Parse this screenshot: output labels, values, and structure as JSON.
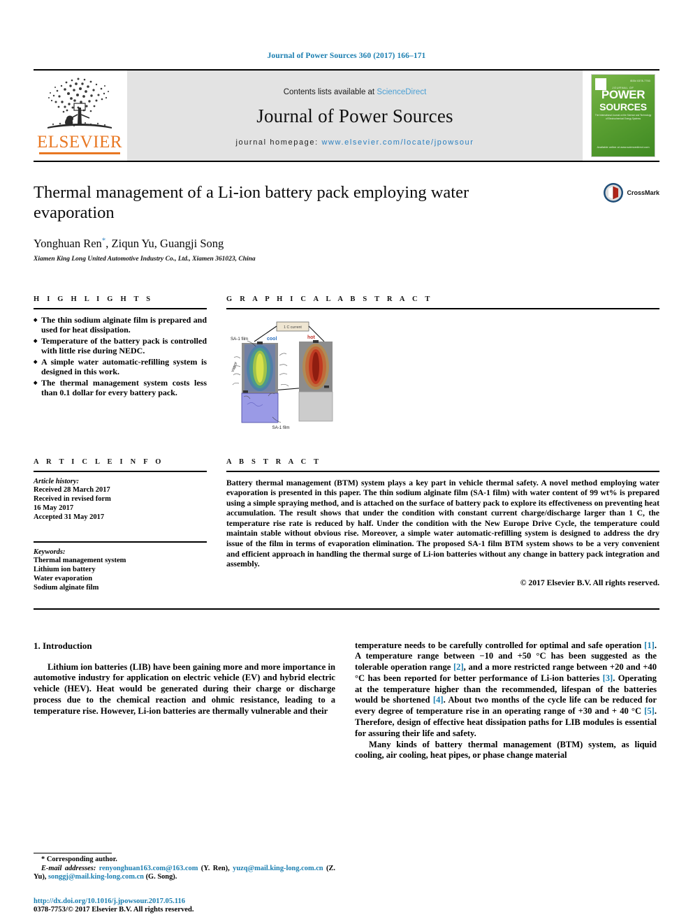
{
  "running_head": "Journal of Power Sources 360 (2017) 166–171",
  "masthead": {
    "publisher": "ELSEVIER",
    "contents_prefix": "Contents lists available at ",
    "contents_link": "ScienceDirect",
    "journal_title": "Journal of Power Sources",
    "homepage_prefix": "journal homepage: ",
    "homepage_url": "www.elsevier.com/locate/jpowsour",
    "cover": {
      "header": "ISSN 0378-7753",
      "eyebrow": "JOURNAL OF",
      "word1": "POWER",
      "word2": "SOURCES",
      "tagline": "The International Journal on the Science and Technology of Electrochemical Energy Systems",
      "footer": "Available online at\nwww.sciencedirect.com",
      "bg_color": "#5ba032"
    }
  },
  "article": {
    "title": "Thermal management of a Li-ion battery pack employing water evaporation",
    "authors": "Yonghuan Ren, Ziqun Yu, Guangji Song",
    "author_marker": "*",
    "affiliation": "Xiamen King Long United Automotive Industry Co., Ltd., Xiamen 361023, China",
    "crossmark_label": "CrossMark"
  },
  "highlights": {
    "heading": "H I G H L I G H T S",
    "items": [
      "The thin sodium alginate film is prepared and used for heat dissipation.",
      "Temperature of the battery pack is controlled with little rise during NEDC.",
      "A simple water automatic-refilling system is designed in this work.",
      "The thermal management system costs less than 0.1 dollar for every battery pack."
    ]
  },
  "graphical_abstract": {
    "heading": "G R A P H I C A L  A B S T R A C T",
    "labels": {
      "top_box": "1 C current",
      "film_left": "SA-1 film",
      "film_bottom": "SA-1 film",
      "vapor": "vapor",
      "cool": "cool",
      "hot": "hot"
    },
    "colors": {
      "cool_text": "#2a6fc0",
      "hot_text": "#c0342a",
      "cell_body": "#8a8a8a",
      "tank_cool": "#8f8fe0",
      "tank_hot": "#c9c9c9"
    }
  },
  "article_info": {
    "heading": "A R T I C L E  I N F O",
    "history_label": "Article history:",
    "history": [
      "Received 28 March 2017",
      "Received in revised form",
      "16 May 2017",
      "Accepted 31 May 2017"
    ],
    "keywords_label": "Keywords:",
    "keywords": [
      "Thermal management system",
      "Lithium ion battery",
      "Water evaporation",
      "Sodium alginate film"
    ]
  },
  "abstract": {
    "heading": "A B S T R A C T",
    "text": "Battery thermal management (BTM) system plays a key part in vehicle thermal safety. A novel method employing water evaporation is presented in this paper. The thin sodium alginate film (SA-1 film) with water content of 99 wt% is prepared using a simple spraying method, and is attached on the surface of battery pack to explore its effectiveness on preventing heat accumulation. The result shows that under the condition with constant current charge/discharge larger than 1 C, the temperature rise rate is reduced by half. Under the condition with the New Europe Drive Cycle, the temperature could maintain stable without obvious rise. Moreover, a simple water automatic-refilling system is designed to address the dry issue of the film in terms of evaporation elimination. The proposed SA-1 film BTM system shows to be a very convenient and efficient approach in handling the thermal surge of Li-ion batteries without any change in battery pack integration and assembly.",
    "copyright": "© 2017 Elsevier B.V. All rights reserved."
  },
  "introduction": {
    "section_number_title": "1. Introduction",
    "left_paragraph": "Lithium ion batteries (LIB) have been gaining more and more importance in automotive industry for application on electric vehicle (EV) and hybrid electric vehicle (HEV). Heat would be generated during their charge or discharge process due to the chemical reaction and ohmic resistance, leading to a temperature rise. However, Li-ion batteries are thermally vulnerable and their",
    "right_paragraph_1_a": "temperature needs to be carefully controlled for optimal and safe operation ",
    "right_cite_1": "[1]",
    "right_paragraph_1_b": ". A temperature range between −10 and +50 °C has been suggested as the tolerable operation range ",
    "right_cite_2": "[2]",
    "right_paragraph_1_c": ", and a more restricted range between +20 and +40 °C has been reported for better performance of Li-ion batteries ",
    "right_cite_3": "[3]",
    "right_paragraph_1_d": ". Operating at the temperature higher than the recommended, lifespan of the batteries would be shortened ",
    "right_cite_4": "[4]",
    "right_paragraph_1_e": ". About two months of the cycle life can be reduced for every degree of temperature rise in an operating range of +30 and + 40 °C ",
    "right_cite_5": "[5]",
    "right_paragraph_1_f": ". Therefore, design of effective heat dissipation paths for LIB modules is essential for assuring their life and safety.",
    "right_paragraph_2": "Many kinds of battery thermal management (BTM) system, as liquid cooling, air cooling, heat pipes, or phase change material"
  },
  "footnotes": {
    "corresponding_marker": "*",
    "corresponding_text": "Corresponding author.",
    "email_label": "E-mail addresses:",
    "email_1": "renyonghuan163.com@163.com",
    "email_1_who": "(Y. Ren),",
    "email_2": "yuzq@mail.king-long.com.cn",
    "email_2_who": "(Z. Yu),",
    "email_3": "songgj@mail.king-long.com.cn",
    "email_3_who": "(G. Song).",
    "doi": "http://dx.doi.org/10.1016/j.jpowsour.2017.05.116",
    "issn": "0378-7753/© 2017 Elsevier B.V. All rights reserved."
  }
}
